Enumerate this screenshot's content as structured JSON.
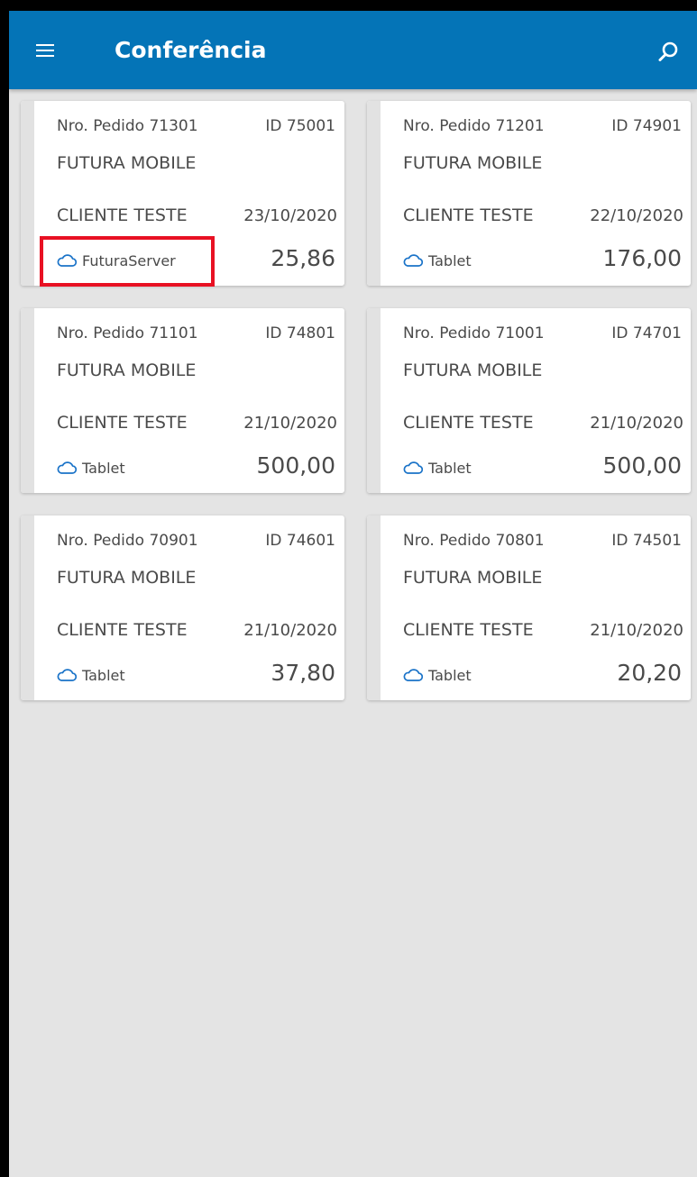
{
  "app": {
    "title": "Conferência"
  },
  "icons": {
    "menu": "menu-icon",
    "search": "search-icon",
    "cloud": "cloud-icon"
  },
  "colors": {
    "appbar": "#0474b7",
    "cloud": "#1a73c8",
    "highlight": "#e81123"
  },
  "orders": [
    {
      "order_no": "Nro. Pedido 71301",
      "id": "ID 75001",
      "company": "FUTURA MOBILE",
      "client": "CLIENTE TESTE",
      "date": "23/10/2020",
      "source": "FuturaServer",
      "amount": "25,86"
    },
    {
      "order_no": "Nro. Pedido 71201",
      "id": "ID 74901",
      "company": "FUTURA MOBILE",
      "client": "CLIENTE TESTE",
      "date": "22/10/2020",
      "source": "Tablet",
      "amount": "176,00"
    },
    {
      "order_no": "Nro. Pedido 71101",
      "id": "ID 74801",
      "company": "FUTURA MOBILE",
      "client": "CLIENTE TESTE",
      "date": "21/10/2020",
      "source": "Tablet",
      "amount": "500,00"
    },
    {
      "order_no": "Nro. Pedido 71001",
      "id": "ID 74701",
      "company": "FUTURA MOBILE",
      "client": "CLIENTE TESTE",
      "date": "21/10/2020",
      "source": "Tablet",
      "amount": "500,00"
    },
    {
      "order_no": "Nro. Pedido 70901",
      "id": "ID 74601",
      "company": "FUTURA MOBILE",
      "client": "CLIENTE TESTE",
      "date": "21/10/2020",
      "source": "Tablet",
      "amount": "37,80"
    },
    {
      "order_no": "Nro. Pedido 70801",
      "id": "ID 74501",
      "company": "FUTURA MOBILE",
      "client": "CLIENTE TESTE",
      "date": "21/10/2020",
      "source": "Tablet",
      "amount": "20,20"
    }
  ]
}
